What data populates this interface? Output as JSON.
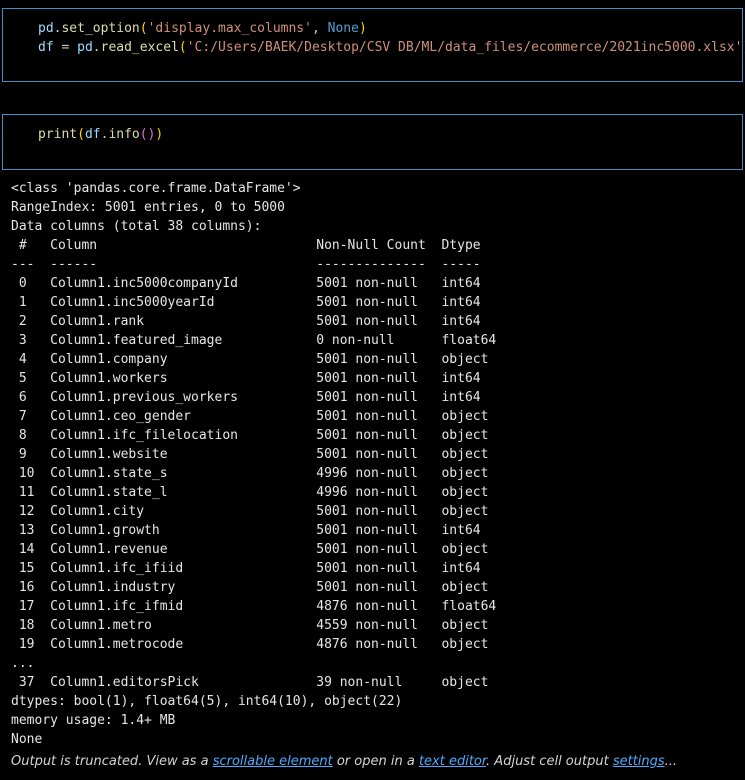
{
  "cells": [
    {
      "lines": [
        [
          {
            "t": "pd",
            "c": "t-plain"
          },
          {
            "t": ".",
            "c": "t-punc"
          },
          {
            "t": "set_option",
            "c": "t-fn"
          },
          {
            "t": "(",
            "c": "t-br1"
          },
          {
            "t": "'display.max_columns'",
            "c": "t-str"
          },
          {
            "t": ", ",
            "c": "t-punc"
          },
          {
            "t": "None",
            "c": "t-kw"
          },
          {
            "t": ")",
            "c": "t-br1"
          }
        ],
        [
          {
            "t": "df",
            "c": "t-plain"
          },
          {
            "t": " = ",
            "c": "t-punc"
          },
          {
            "t": "pd",
            "c": "t-plain"
          },
          {
            "t": ".",
            "c": "t-punc"
          },
          {
            "t": "read_excel",
            "c": "t-fn"
          },
          {
            "t": "(",
            "c": "t-br1"
          },
          {
            "t": "'C:/Users/BAEK/Desktop/CSV DB/ML/data_files/ecommerce/2021inc5000.xlsx'",
            "c": "t-str"
          },
          {
            "t": ")",
            "c": "t-br1"
          }
        ]
      ]
    },
    {
      "lines": [
        [
          {
            "t": "print",
            "c": "t-fn"
          },
          {
            "t": "(",
            "c": "t-br1"
          },
          {
            "t": "df",
            "c": "t-plain"
          },
          {
            "t": ".",
            "c": "t-punc"
          },
          {
            "t": "info",
            "c": "t-fn"
          },
          {
            "t": "(",
            "c": "t-br2"
          },
          {
            "t": ")",
            "c": "t-br2"
          },
          {
            "t": ")",
            "c": "t-br1"
          }
        ]
      ]
    }
  ],
  "output_lines": [
    "<class 'pandas.core.frame.DataFrame'>",
    "RangeIndex: 5001 entries, 0 to 5000",
    "Data columns (total 38 columns):",
    " #   Column                            Non-Null Count  Dtype  ",
    "---  ------                            --------------  -----  ",
    " 0   Column1.inc5000companyId          5001 non-null   int64  ",
    " 1   Column1.inc5000yearId             5001 non-null   int64  ",
    " 2   Column1.rank                      5001 non-null   int64  ",
    " 3   Column1.featured_image            0 non-null      float64",
    " 4   Column1.company                   5001 non-null   object ",
    " 5   Column1.workers                   5001 non-null   int64  ",
    " 6   Column1.previous_workers          5001 non-null   int64  ",
    " 7   Column1.ceo_gender                5001 non-null   object ",
    " 8   Column1.ifc_filelocation          5001 non-null   object ",
    " 9   Column1.website                   5001 non-null   object ",
    " 10  Column1.state_s                   4996 non-null   object ",
    " 11  Column1.state_l                   4996 non-null   object ",
    " 12  Column1.city                      5001 non-null   object ",
    " 13  Column1.growth                    5001 non-null   int64  ",
    " 14  Column1.revenue                   5001 non-null   object ",
    " 15  Column1.ifc_ifiid                 5001 non-null   int64  ",
    " 16  Column1.industry                  5001 non-null   object ",
    " 17  Column1.ifc_ifmid                 4876 non-null   float64",
    " 18  Column1.metro                     4559 non-null   object ",
    " 19  Column1.metrocode                 4876 non-null   object ",
    "...",
    " 37  Column1.editorsPick               39 non-null     object ",
    "dtypes: bool(1), float64(5), int64(10), object(22)",
    "memory usage: 1.4+ MB",
    "None"
  ],
  "truncation": {
    "prefix": "Output is truncated. View as a ",
    "link1": "scrollable element",
    "mid": " or open in a ",
    "link2": "text editor",
    "mid2": ". Adjust cell output ",
    "link3": "settings",
    "suffix": "..."
  }
}
